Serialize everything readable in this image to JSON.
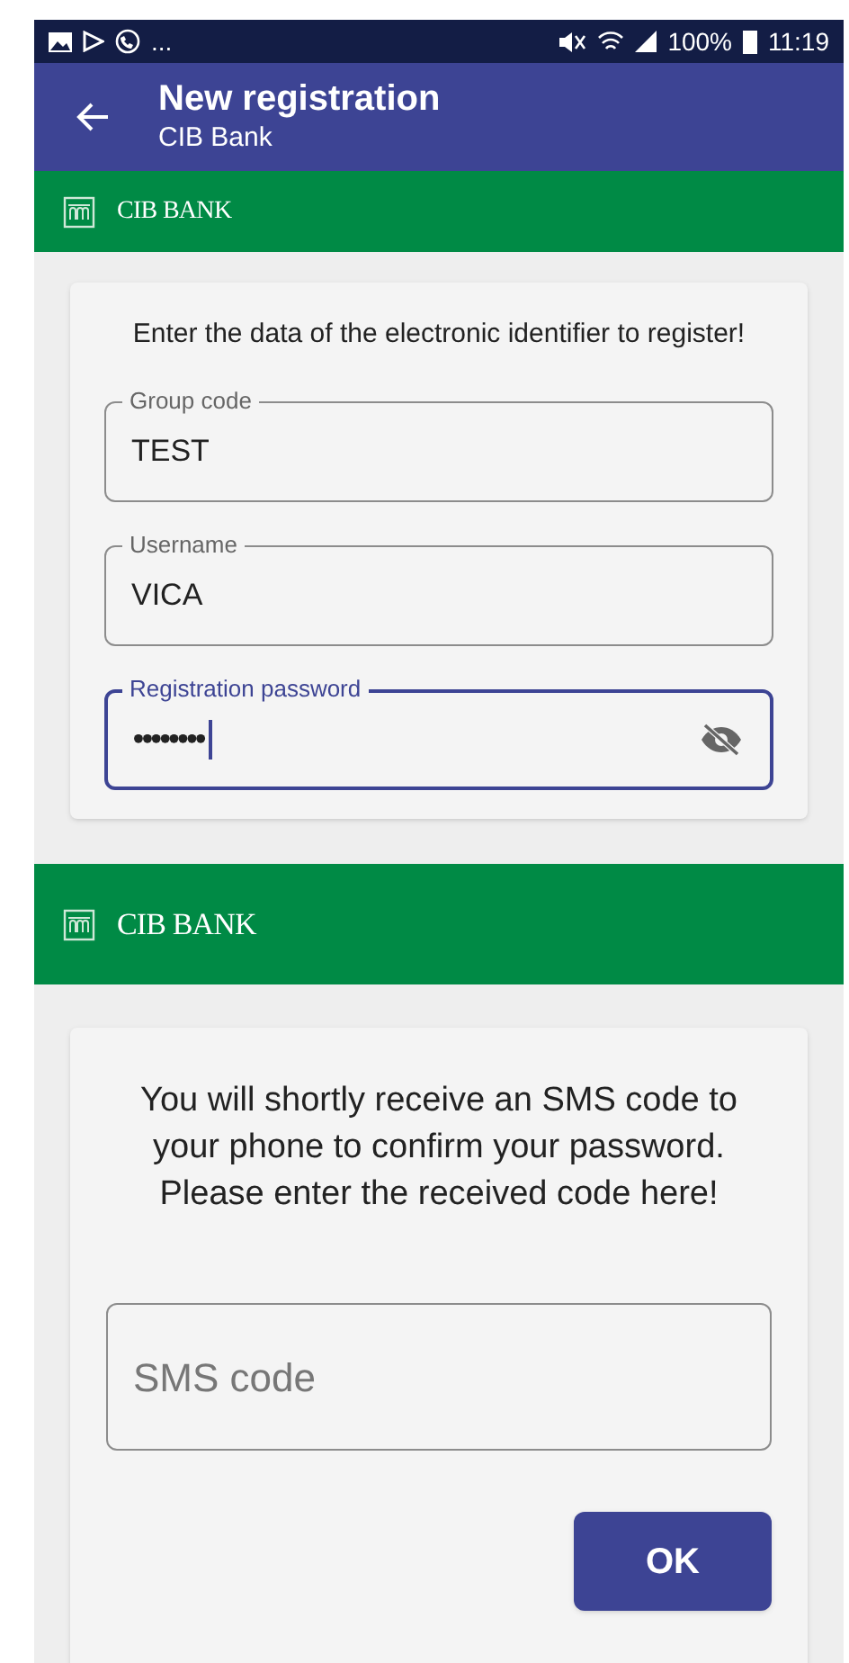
{
  "status_bar": {
    "more": "...",
    "battery": "100%",
    "time": "11:19"
  },
  "app_bar": {
    "title": "New registration",
    "subtitle": "CIB Bank"
  },
  "screens": [
    {
      "brand": "CIB BANK",
      "kind": "registration",
      "instruction": "Enter the data of the electronic identifier to register!",
      "fields": [
        {
          "label": "Group code",
          "value": "TEST",
          "focused": false,
          "secret": false
        },
        {
          "label": "Username",
          "value": "VICA",
          "focused": false,
          "secret": false
        },
        {
          "label": "Registration password",
          "value": "••••••••",
          "focused": true,
          "secret": true
        }
      ]
    },
    {
      "brand": "CIB BANK",
      "kind": "sms",
      "instruction": "You will shortly receive an SMS code to your phone to confirm your password. Please enter the received code here!",
      "placeholder": "SMS code",
      "button": "OK"
    }
  ]
}
